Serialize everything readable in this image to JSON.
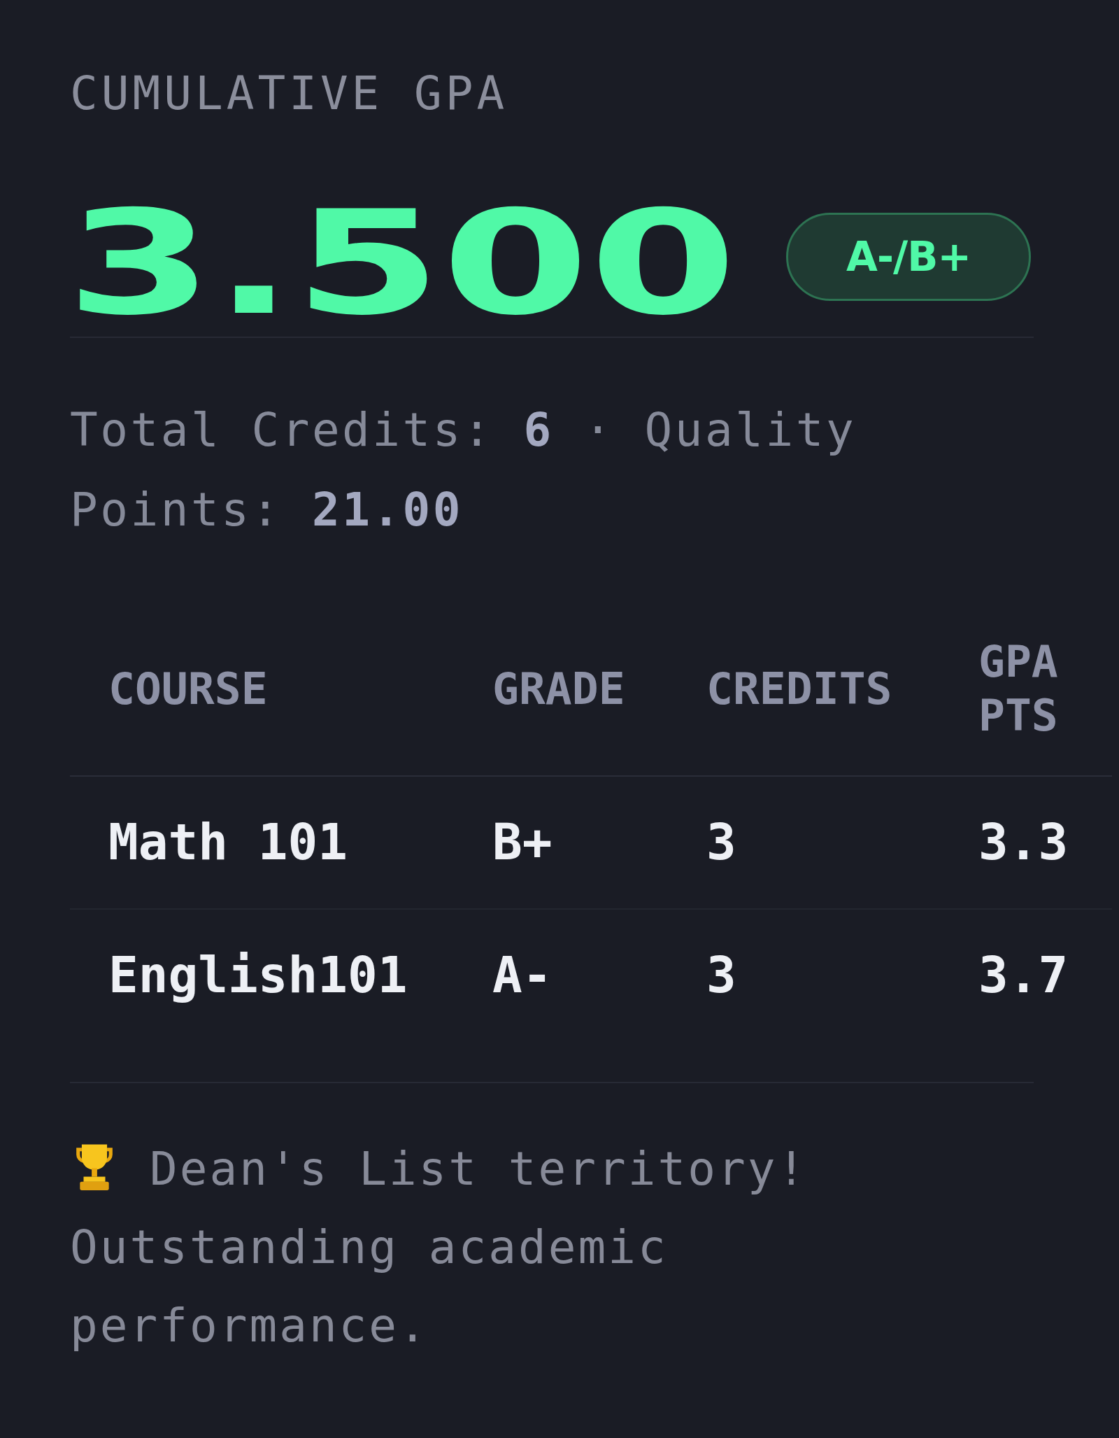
{
  "card": {
    "label": "CUMULATIVE GPA",
    "gpa": "3.500",
    "grade_badge": "A-/B+",
    "summary": "Total Credits: **6** · Quality Points: **21.00**"
  },
  "table": {
    "columns": [
      "COURSE",
      "GRADE",
      "CREDITS",
      "GPA PTS"
    ],
    "rows": [
      {
        "cells": [
          "Math 101",
          "B+",
          "3",
          "3.3"
        ]
      },
      {
        "cells": [
          "English101",
          "A-",
          "3",
          "3.7"
        ]
      }
    ]
  },
  "footer": {
    "headline": "Dean's List territory!",
    "message": "Outstanding academic performance."
  }
}
